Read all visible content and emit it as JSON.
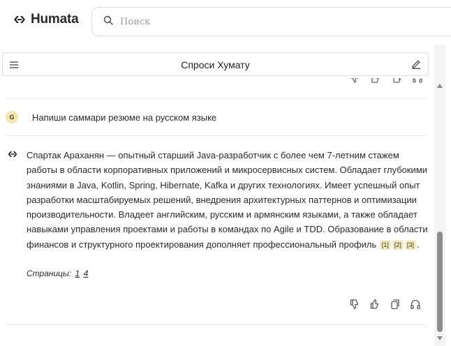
{
  "app": {
    "name": "Humata"
  },
  "search": {
    "placeholder": "Поиск"
  },
  "chat": {
    "title": "Спроси Хумату"
  },
  "user_message": {
    "avatar_letter": "G",
    "text": "Напиши саммари резюме на русском языке"
  },
  "bot_message": {
    "text": "Спартак Араханян — опытный старший Java-разработчик с более чем 7-летним стажем работы в области корпоративных приложений и микросервисных систем. Обладает глубокими знаниями в Java, Kotlin, Spring, Hibernate, Kafka и других технологиях. Имеет успешный опыт разработки масштабируемых решений, внедрения архитектурных паттернов и оптимизации производительности. Владеет английским, русским и армянским языками, а также обладает навыками управления проектами и работы в командах по Agile и TDD. Образование в области финансов и структурного проектирования дополняет профессиональный профиль",
    "citations": [
      "[1]",
      "[2]",
      "[3]"
    ],
    "end_punct": ".",
    "pages_label": "Страницы:",
    "pages": [
      "1",
      "4"
    ]
  },
  "colors": {
    "citation_bg": "#f3ebc6",
    "avatar_bg": "#f1e6b4",
    "scroll_thumb": "#8d8d8d"
  },
  "icons": {
    "logo": "humata-logo-icon",
    "search": "search-icon",
    "menu": "menu-icon",
    "edit": "edit-icon",
    "actions": [
      "thumbs-down-icon",
      "thumbs-up-icon",
      "copy-icon",
      "headphones-icon"
    ]
  }
}
